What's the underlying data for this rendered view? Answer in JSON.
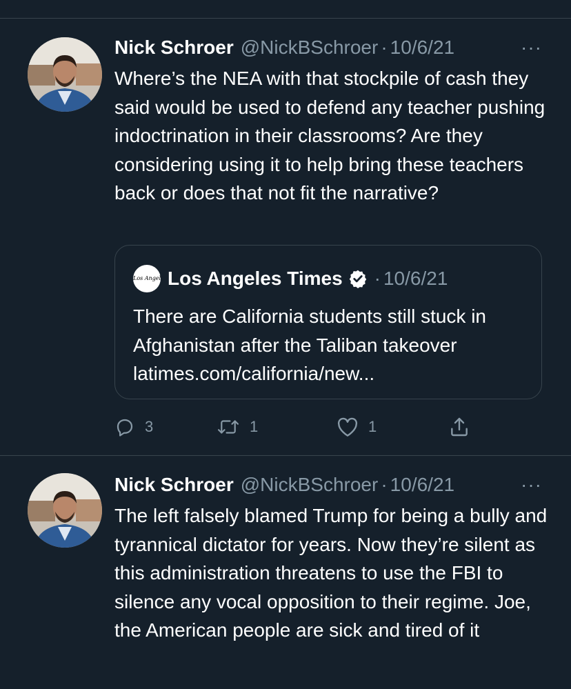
{
  "tweets": [
    {
      "display_name": "Nick Schroer",
      "handle": "@NickBSchroer",
      "separator": "·",
      "date": "10/6/21",
      "more_label": "···",
      "text": "Where’s the NEA with that stockpile of cash they said would be used to defend any teacher pushing indoctrination in their classrooms? Are they considering using it to help bring these teachers back or does that not fit the narrative?",
      "quoted": {
        "logo_text": "Los Angeles Times",
        "name": "Los Angeles Times",
        "separator": "·",
        "date": "10/6/21",
        "text": "There are California students still stuck in Afghanistan after the Taliban takeover latimes.com/california/new..."
      },
      "actions": {
        "reply_count": "3",
        "retweet_count": "1",
        "like_count": "1"
      }
    },
    {
      "display_name": "Nick Schroer",
      "handle": "@NickBSchroer",
      "separator": "·",
      "date": "10/6/21",
      "more_label": "···",
      "text": "The left falsely blamed Trump for being a bully and tyrannical dictator for years. Now they’re silent as this administration threatens to use the FBI to silence any vocal opposition to their regime. Joe, the American people are sick and tired of it"
    }
  ],
  "icons": {
    "reply": "reply-icon",
    "retweet": "retweet-icon",
    "like": "heart-icon",
    "share": "share-icon",
    "verified": "verified-badge-icon",
    "more": "more-icon"
  },
  "colors": {
    "background": "#15202b",
    "divider": "#38444d",
    "secondary_text": "#8899a6",
    "primary_text": "#ffffff"
  }
}
